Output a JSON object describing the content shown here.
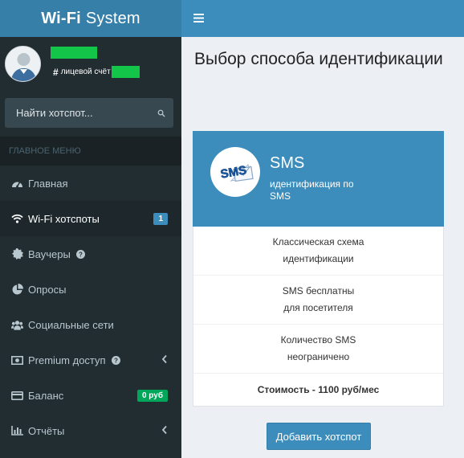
{
  "brand": {
    "bold": "Wi-Fi",
    "rest": "System"
  },
  "user": {
    "account_label": "лицевой счёт"
  },
  "search": {
    "placeholder": "Найти хотспот..."
  },
  "menu_header": "ГЛАВНОЕ МЕНЮ",
  "menu": [
    {
      "label": "Главная"
    },
    {
      "label": "Wi-Fi хотспоты",
      "badge": "1"
    },
    {
      "label": "Ваучеры"
    },
    {
      "label": "Опросы"
    },
    {
      "label": "Социальные сети"
    },
    {
      "label": "Premium доступ"
    },
    {
      "label": "Баланс",
      "badge": "0 руб"
    },
    {
      "label": "Отчёты"
    }
  ],
  "page": {
    "title": "Выбор способа идентификации"
  },
  "card": {
    "logo_text": "SMS",
    "title": "SMS",
    "subtitle": "идентификация по SMS",
    "features": [
      {
        "line1": "Классическая схема",
        "line2": "идентификации"
      },
      {
        "line1": "SMS бесплатны",
        "line2": "для посетителя"
      },
      {
        "line1": "Количество SMS",
        "line2": "неограничено"
      }
    ],
    "price": "Стоимость - 1100 руб/мес"
  },
  "add_button": "Добавить хотспот",
  "colors": {
    "accent": "#3c8dbc",
    "sidebar": "#222d32",
    "badge_green": "#00a65a",
    "redacted": "#13c649"
  }
}
